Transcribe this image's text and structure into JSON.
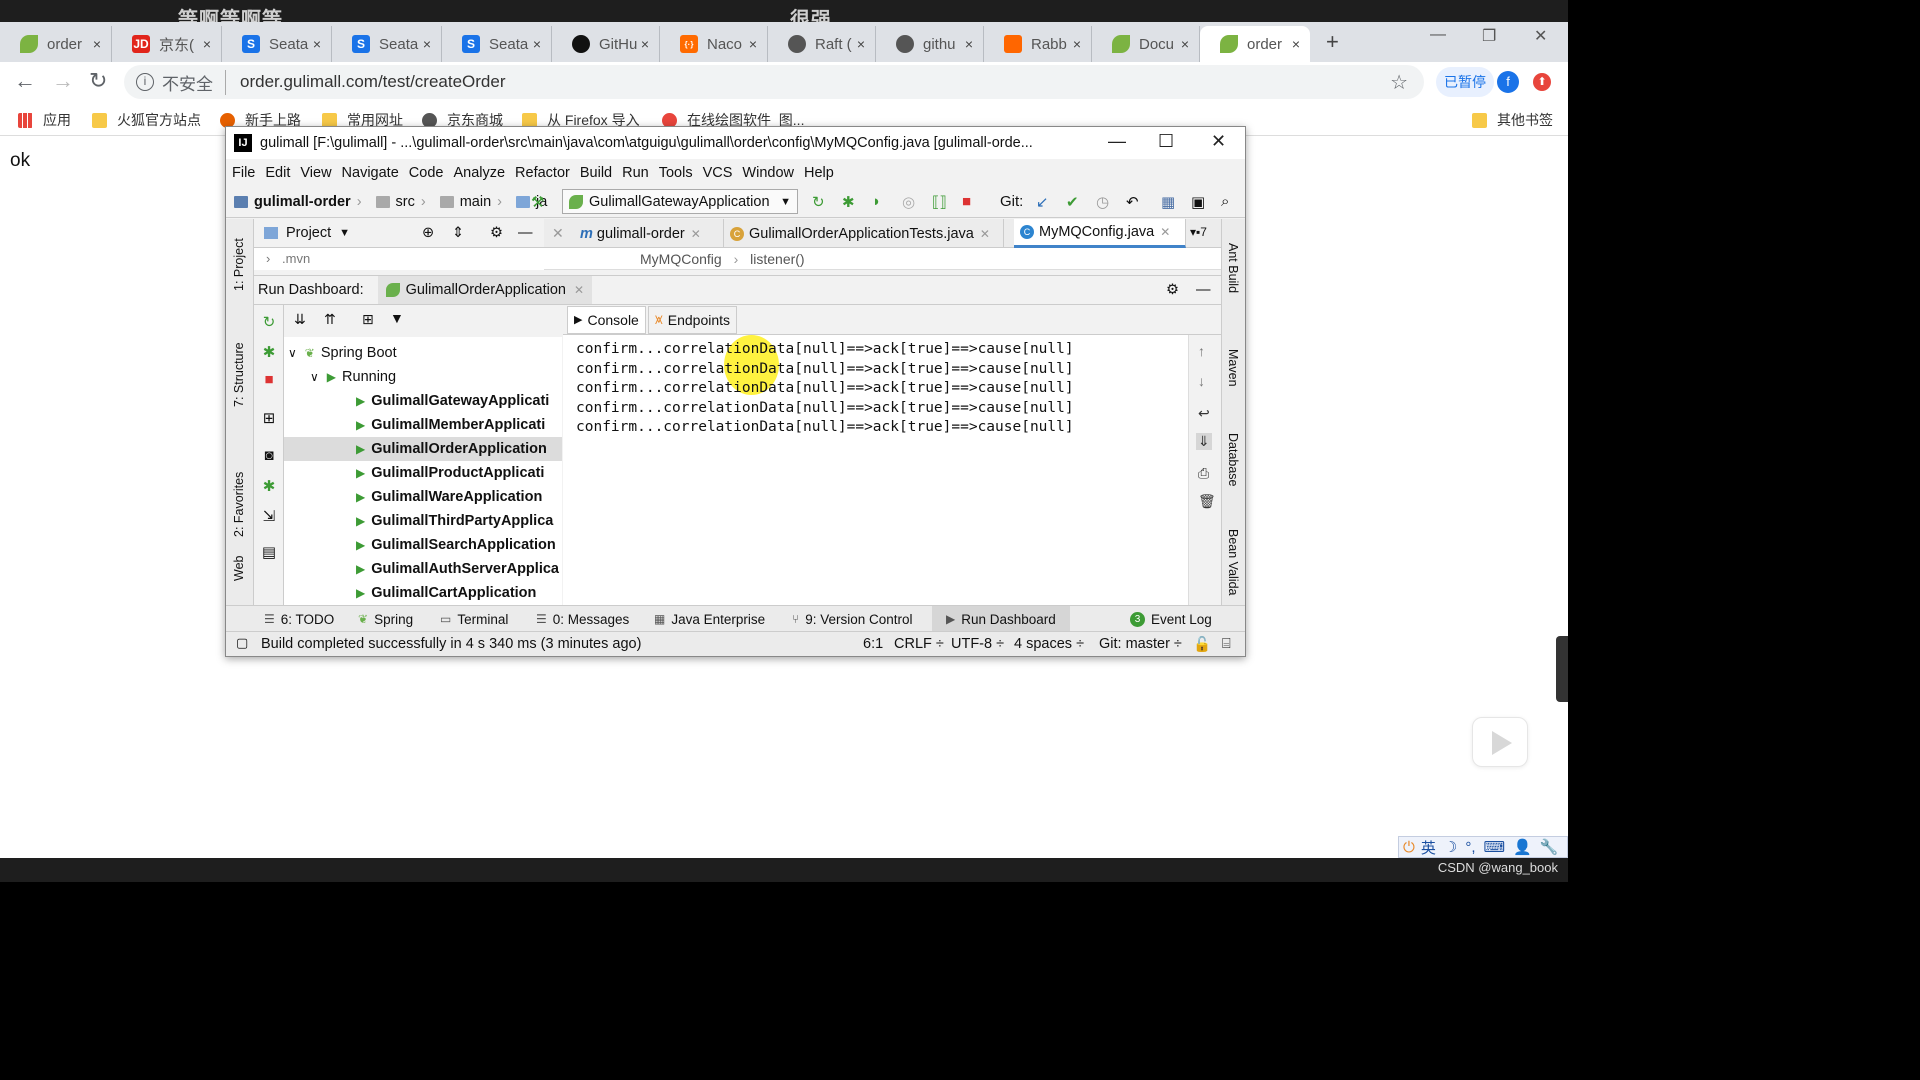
{
  "overlay": {
    "left_text": "等啊等啊等",
    "center_text": "很强"
  },
  "browser": {
    "tabs": [
      {
        "label": "order",
        "color": "#7cb342",
        "glyph": ""
      },
      {
        "label": "京东(",
        "color": "#e1251b",
        "glyph": "JD"
      },
      {
        "label": "Seata",
        "color": "#1a73e8",
        "glyph": "S"
      },
      {
        "label": "Seata",
        "color": "#1a73e8",
        "glyph": "S"
      },
      {
        "label": "Seata",
        "color": "#1a73e8",
        "glyph": "S"
      },
      {
        "label": "GitHu",
        "color": "#111111",
        "glyph": "●"
      },
      {
        "label": "Naco",
        "color": "#ff6a00",
        "glyph": "{·}"
      },
      {
        "label": "Raft (",
        "color": "#555555",
        "glyph": "◉"
      },
      {
        "label": "githu",
        "color": "#555555",
        "glyph": "◉"
      },
      {
        "label": "Rabb",
        "color": "#ff6600",
        "glyph": "▙"
      },
      {
        "label": "Docu",
        "color": "#7cb342",
        "glyph": ""
      },
      {
        "label": "order",
        "color": "#7cb342",
        "glyph": ""
      }
    ],
    "tab_close": "×",
    "new_tab": "+",
    "insecure_label": "不安全",
    "url": "order.gulimall.com/test/createOrder",
    "paused_label": "已暂停",
    "avatar_letter": "f",
    "bookmarks": [
      "应用",
      "火狐官方站点",
      "新手上路",
      "常用网址",
      "京东商城",
      "从 Firefox 导入",
      "在线绘图软件_图...",
      "其他书签"
    ]
  },
  "page": {
    "body_text": "ok"
  },
  "ide": {
    "title": "gulimall [F:\\gulimall] - ...\\gulimall-order\\src\\main\\java\\com\\atguigu\\gulimall\\order\\config\\MyMQConfig.java [gulimall-orde...",
    "menu": [
      "File",
      "Edit",
      "View",
      "Navigate",
      "Code",
      "Analyze",
      "Refactor",
      "Build",
      "Run",
      "Tools",
      "VCS",
      "Window",
      "Help"
    ],
    "breadcrumbs": [
      "gulimall-order",
      "src",
      "main",
      "ja"
    ],
    "run_config": "GulimallGatewayApplication",
    "git_label": "Git:",
    "project_label": "Project",
    "project_row": ".mvn",
    "editor_tabs": [
      "gulimall-order",
      "GulimallOrderApplicationTests.java",
      "MyMQConfig.java"
    ],
    "editor_tab_count": "7",
    "editor_crumbs": [
      "MyMQConfig",
      "listener()"
    ],
    "run_dashboard_label": "Run Dashboard:",
    "run_dashboard_tab": "GulimallOrderApplication",
    "tree": {
      "root": "Spring Boot",
      "group": "Running",
      "apps": [
        "GulimallGatewayApplicati",
        "GulimallMemberApplicati",
        "GulimallOrderApplication",
        "GulimallProductApplicati",
        "GulimallWareApplication",
        "GulimallThirdPartyApplica",
        "GulimallSearchApplication",
        "GulimallAuthServerApplica",
        "GulimallCartApplication"
      ],
      "selected_index": 2
    },
    "console_tabs": [
      "Console",
      "Endpoints"
    ],
    "console_lines": [
      "confirm...correlationData[null]==>ack[true]==>cause[null]",
      "confirm...correlationData[null]==>ack[true]==>cause[null]",
      "confirm...correlationData[null]==>ack[true]==>cause[null]",
      "confirm...correlationData[null]==>ack[true]==>cause[null]",
      "confirm...correlationData[null]==>ack[true]==>cause[null]"
    ],
    "left_stripe": [
      "1: Project",
      "7: Structure",
      "2: Favorites",
      "Web"
    ],
    "right_stripe": [
      "Ant Build",
      "Maven",
      "Database",
      "Bean Valida"
    ],
    "bottom_tools": [
      "6: TODO",
      "Spring",
      "Terminal",
      "0: Messages",
      "Java Enterprise",
      "9: Version Control",
      "Run Dashboard",
      "Event Log"
    ],
    "status": {
      "message": "Build completed successfully in 4 s 340 ms (3 minutes ago)",
      "position": "6:1",
      "line_sep": "CRLF ÷",
      "encoding": "UTF-8 ÷",
      "indent": "4 spaces ÷",
      "git_branch": "Git: master ÷"
    }
  },
  "taskbar": {
    "ime_text": "英",
    "watermark": "CSDN @wang_book"
  }
}
